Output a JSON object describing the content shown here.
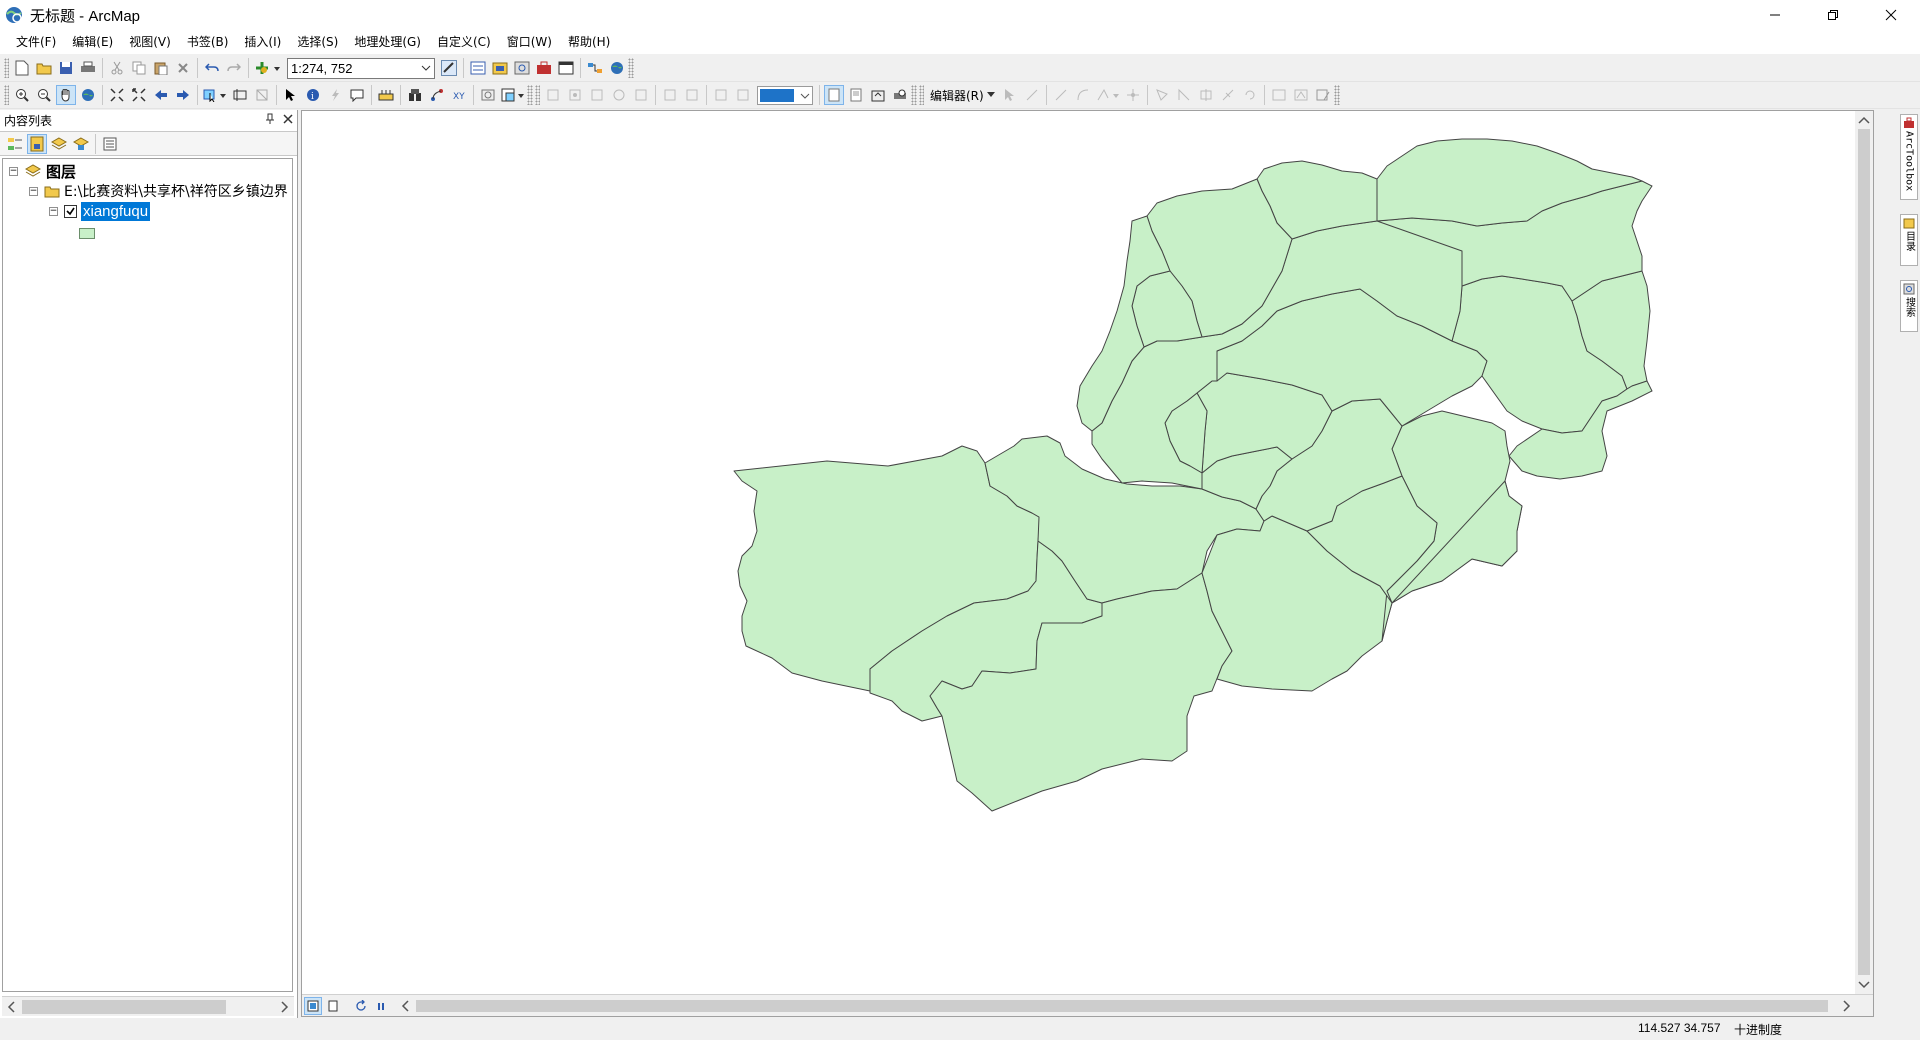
{
  "window": {
    "title": "无标题 - ArcMap",
    "buttons": [
      "minimize-icon",
      "restore-icon",
      "close-icon"
    ]
  },
  "menubar": {
    "items": [
      "文件(F)",
      "编辑(E)",
      "视图(V)",
      "书签(B)",
      "插入(I)",
      "选择(S)",
      "地理处理(G)",
      "自定义(C)",
      "窗口(W)",
      "帮助(H)"
    ]
  },
  "toolbar": {
    "scale_value": "1:274, 752",
    "editor_label": "编辑器(R)",
    "fill_color": "#1e73c8"
  },
  "toc": {
    "title": "内容列表",
    "root_label": "图层",
    "folder_label": "E:\\比赛资料\\共享杯\\祥符区乡镇边界",
    "layer_name": "xiangfuqu",
    "layer_checked": true
  },
  "map": {
    "polygon_fill": "#c8f0c8",
    "polygon_stroke": "#444444"
  },
  "dock_tabs": {
    "toolbox": "ArcToolbox",
    "catalog": "目录",
    "search": "搜索"
  },
  "status": {
    "coordinates": "114.527  34.757",
    "units": "十进制度"
  }
}
